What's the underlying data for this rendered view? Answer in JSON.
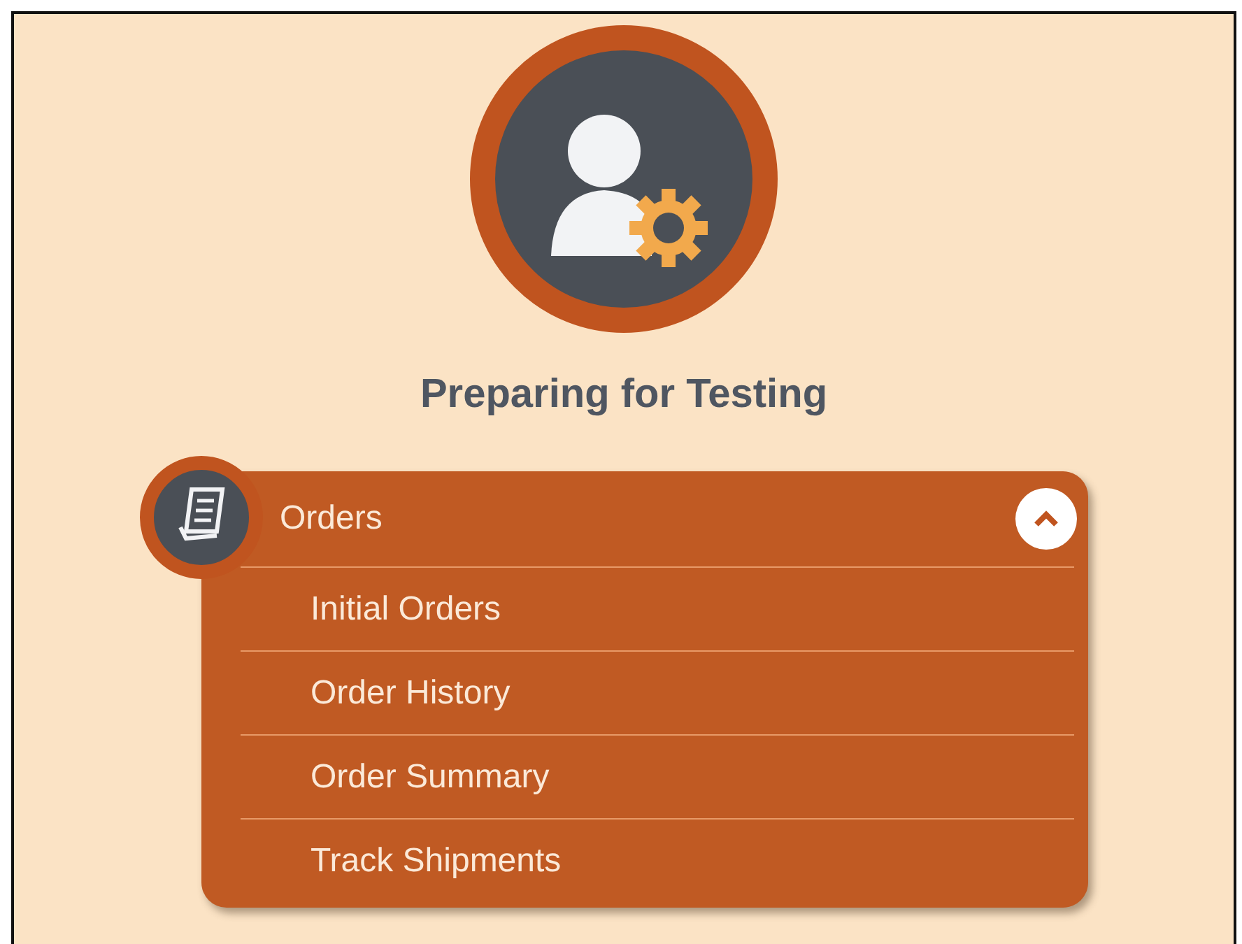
{
  "title": "Preparing for Testing",
  "menu": {
    "label": "Orders",
    "expanded": true,
    "items": [
      {
        "label": "Initial Orders"
      },
      {
        "label": "Order History"
      },
      {
        "label": "Order Summary"
      },
      {
        "label": "Track Shipments"
      }
    ]
  }
}
